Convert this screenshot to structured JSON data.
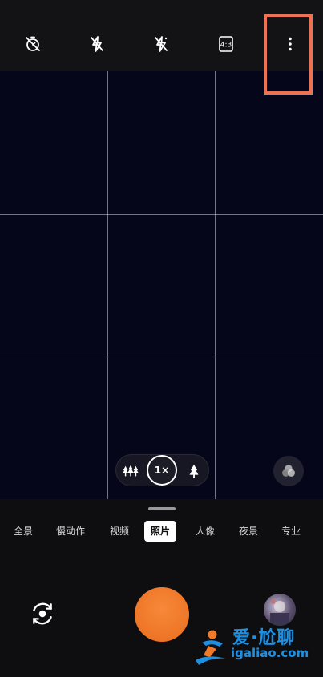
{
  "topbar": {
    "icons": [
      "timer-off-icon",
      "flash-off-icon",
      "auto-flash-off-icon",
      "aspect-ratio-icon",
      "more-vert-icon"
    ],
    "aspect_ratio": "4:3"
  },
  "viewfinder": {
    "grid": "3x3",
    "zoom": {
      "wide_icon": "multi-tree-icon",
      "current": "1×",
      "tele_icon": "single-tree-icon"
    },
    "filter_icon": "color-filter-icon"
  },
  "modes": {
    "items": [
      "全景",
      "慢动作",
      "视频",
      "照片",
      "人像",
      "夜景",
      "专业"
    ],
    "selected": "照片"
  },
  "controls": {
    "switch_camera_icon": "switch-camera-icon",
    "shutter_color": "#f07a2a",
    "gallery_icon": "gallery-thumbnail"
  },
  "watermark": {
    "title": "爱·尬聊",
    "url": "igaliao.com"
  },
  "colors": {
    "highlight": "#ee7151",
    "shutter": "#f07a2a",
    "watermark": "#1f8fe0"
  }
}
